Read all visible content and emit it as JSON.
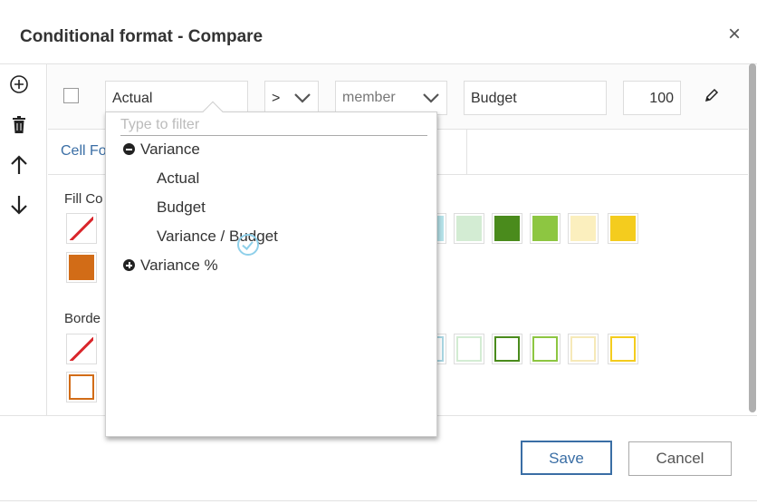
{
  "dialog": {
    "title": "Conditional format - Compare",
    "close_symbol": "×"
  },
  "rule": {
    "measure_value": "Actual",
    "operator_value": ">",
    "compare_type_value": "member",
    "compare_member_value": "Budget",
    "percent_value": "100"
  },
  "tabs": {
    "cell_format_label": "Cell Fo"
  },
  "sections": {
    "fill_label": "Fill Co",
    "border_label": "Borde"
  },
  "fill_colors": [
    "#b6e3ea",
    "#d3ecd3",
    "#4a8b1c",
    "#8dc641",
    "#fbefbe",
    "#f4cc1e",
    "#d26c17"
  ],
  "border_colors": [
    "#a9d6e2",
    "#d3ecd3",
    "#4a8b1c",
    "#8dc641",
    "#f6e9b8",
    "#f4cc1e",
    "#d26c17"
  ],
  "dropdown": {
    "filter_placeholder": "Type to filter",
    "items": {
      "variance": "Variance",
      "actual": "Actual",
      "budget": "Budget",
      "variance_budget": "Variance / Budget",
      "variance_pct": "Variance %"
    }
  },
  "footer": {
    "save_label": "Save",
    "cancel_label": "Cancel"
  },
  "colors": {
    "accent": "#3a6ea5",
    "no_color": "#d9262b"
  }
}
